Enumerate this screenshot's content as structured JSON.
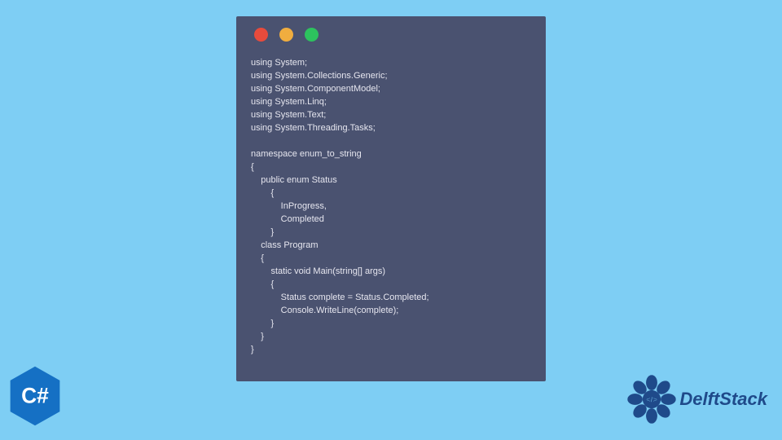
{
  "window": {
    "dots": {
      "red": "#e84b3c",
      "yellow": "#f0ad3f",
      "green": "#2dc25e"
    }
  },
  "code": {
    "lines": [
      "using System;",
      "using System.Collections.Generic;",
      "using System.ComponentModel;",
      "using System.Linq;",
      "using System.Text;",
      "using System.Threading.Tasks;",
      "",
      "namespace enum_to_string",
      "{",
      "    public enum Status",
      "        {",
      "            InProgress,",
      "            Completed",
      "        }",
      "    class Program",
      "    {",
      "        static void Main(string[] args)",
      "        {",
      "            Status complete = Status.Completed;",
      "            Console.WriteLine(complete);",
      "        }",
      "    }",
      "}"
    ]
  },
  "badge": {
    "text": "C#",
    "fill": "#1570c4"
  },
  "brand": {
    "name": "DelftStack",
    "logo_fill": "#1f4a8a"
  }
}
